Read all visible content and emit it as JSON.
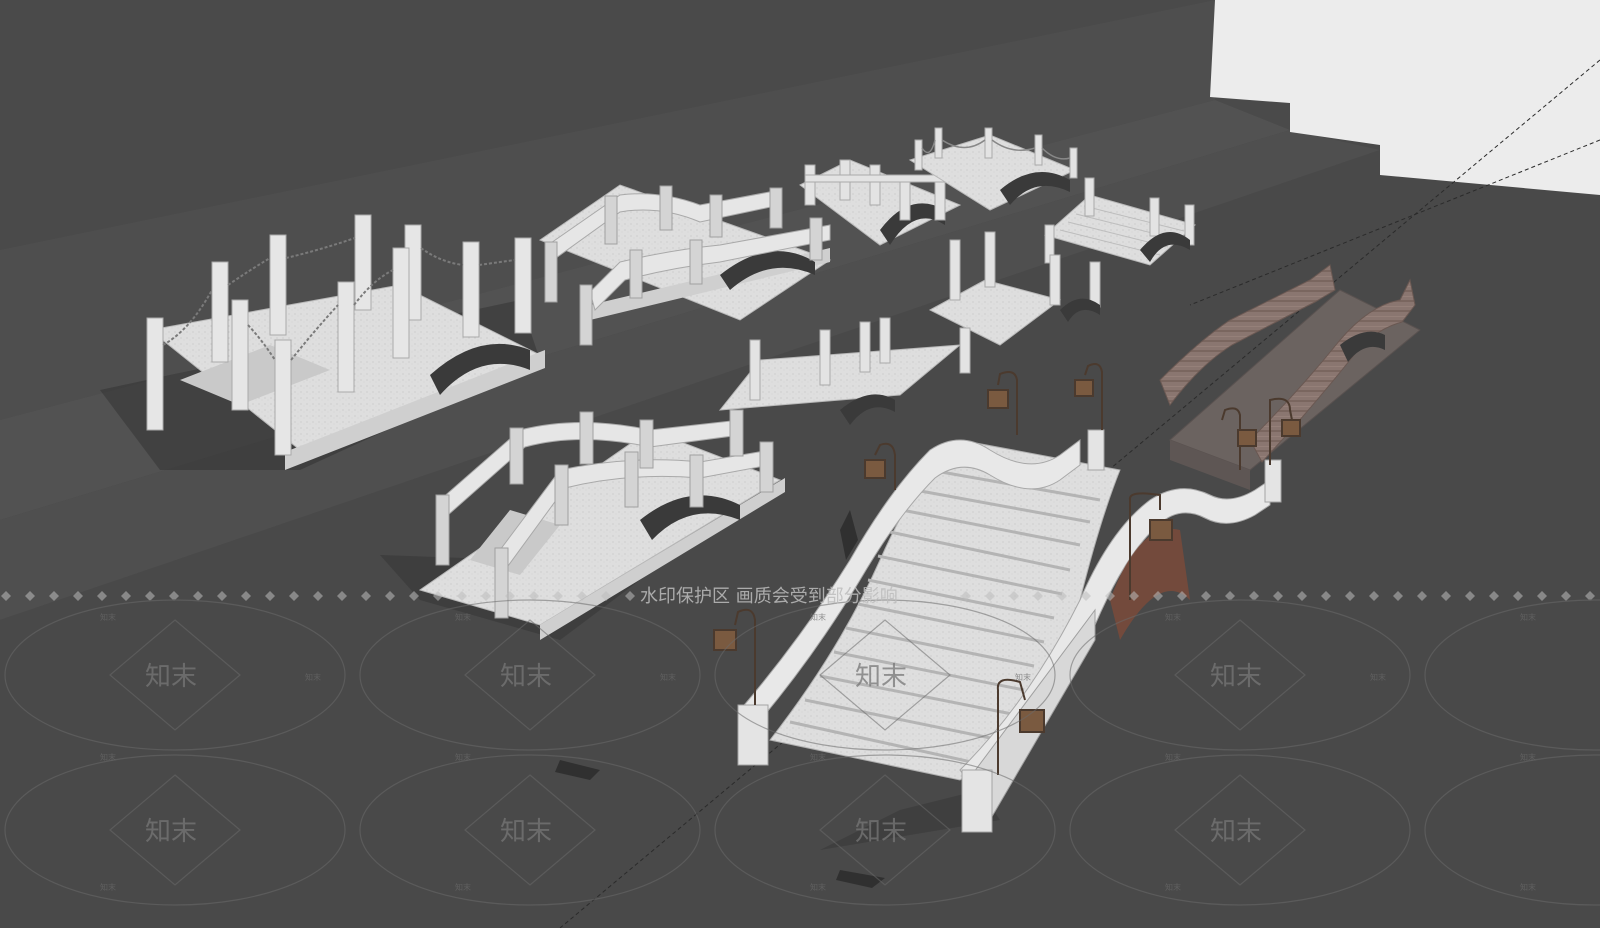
{
  "watermark": {
    "banner": "水印保护区  画质会受到部分影响",
    "brand": "知末",
    "tag": "知末"
  },
  "colors": {
    "ground": "#4a4a4a",
    "ground_step": "#545454",
    "sky_panel": "#ececec",
    "stone": "#dcdcdc",
    "stone_shadow": "#9a9a9a",
    "wood_bridge": "#8a7670",
    "lamp": "#6a4a34"
  },
  "scene": {
    "description_icon": "bridge-models",
    "bridges": [
      {
        "name": "chain-rail-arch-bridge"
      },
      {
        "name": "balustrade-arch-bridge-large"
      },
      {
        "name": "twin-arch-bridge-back"
      },
      {
        "name": "rope-rail-arch-bridge"
      },
      {
        "name": "stair-arch-bridge-right"
      },
      {
        "name": "carved-panel-bridge"
      },
      {
        "name": "balustrade-arch-bridge-front"
      },
      {
        "name": "wavy-rail-stone-bridge-main"
      },
      {
        "name": "wooden-wavy-rail-bridge"
      }
    ]
  }
}
